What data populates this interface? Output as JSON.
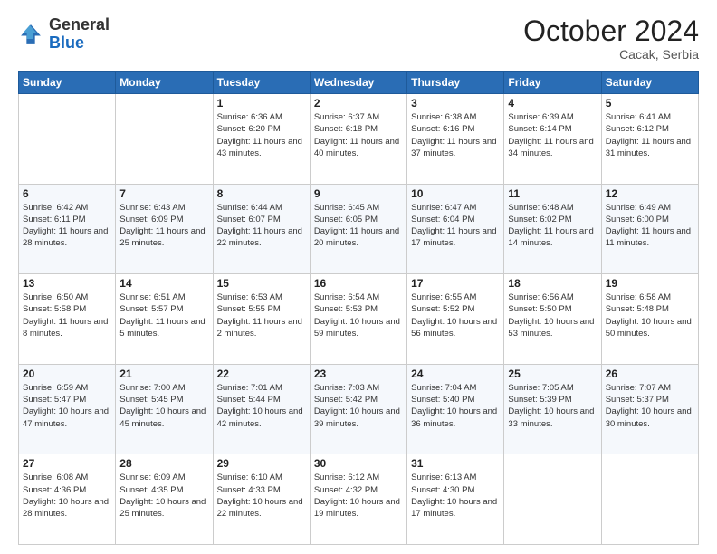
{
  "header": {
    "logo_general": "General",
    "logo_blue": "Blue",
    "month_title": "October 2024",
    "location": "Cacak, Serbia"
  },
  "weekdays": [
    "Sunday",
    "Monday",
    "Tuesday",
    "Wednesday",
    "Thursday",
    "Friday",
    "Saturday"
  ],
  "weeks": [
    [
      {
        "day": "",
        "info": ""
      },
      {
        "day": "",
        "info": ""
      },
      {
        "day": "1",
        "info": "Sunrise: 6:36 AM\nSunset: 6:20 PM\nDaylight: 11 hours and 43 minutes."
      },
      {
        "day": "2",
        "info": "Sunrise: 6:37 AM\nSunset: 6:18 PM\nDaylight: 11 hours and 40 minutes."
      },
      {
        "day": "3",
        "info": "Sunrise: 6:38 AM\nSunset: 6:16 PM\nDaylight: 11 hours and 37 minutes."
      },
      {
        "day": "4",
        "info": "Sunrise: 6:39 AM\nSunset: 6:14 PM\nDaylight: 11 hours and 34 minutes."
      },
      {
        "day": "5",
        "info": "Sunrise: 6:41 AM\nSunset: 6:12 PM\nDaylight: 11 hours and 31 minutes."
      }
    ],
    [
      {
        "day": "6",
        "info": "Sunrise: 6:42 AM\nSunset: 6:11 PM\nDaylight: 11 hours and 28 minutes."
      },
      {
        "day": "7",
        "info": "Sunrise: 6:43 AM\nSunset: 6:09 PM\nDaylight: 11 hours and 25 minutes."
      },
      {
        "day": "8",
        "info": "Sunrise: 6:44 AM\nSunset: 6:07 PM\nDaylight: 11 hours and 22 minutes."
      },
      {
        "day": "9",
        "info": "Sunrise: 6:45 AM\nSunset: 6:05 PM\nDaylight: 11 hours and 20 minutes."
      },
      {
        "day": "10",
        "info": "Sunrise: 6:47 AM\nSunset: 6:04 PM\nDaylight: 11 hours and 17 minutes."
      },
      {
        "day": "11",
        "info": "Sunrise: 6:48 AM\nSunset: 6:02 PM\nDaylight: 11 hours and 14 minutes."
      },
      {
        "day": "12",
        "info": "Sunrise: 6:49 AM\nSunset: 6:00 PM\nDaylight: 11 hours and 11 minutes."
      }
    ],
    [
      {
        "day": "13",
        "info": "Sunrise: 6:50 AM\nSunset: 5:58 PM\nDaylight: 11 hours and 8 minutes."
      },
      {
        "day": "14",
        "info": "Sunrise: 6:51 AM\nSunset: 5:57 PM\nDaylight: 11 hours and 5 minutes."
      },
      {
        "day": "15",
        "info": "Sunrise: 6:53 AM\nSunset: 5:55 PM\nDaylight: 11 hours and 2 minutes."
      },
      {
        "day": "16",
        "info": "Sunrise: 6:54 AM\nSunset: 5:53 PM\nDaylight: 10 hours and 59 minutes."
      },
      {
        "day": "17",
        "info": "Sunrise: 6:55 AM\nSunset: 5:52 PM\nDaylight: 10 hours and 56 minutes."
      },
      {
        "day": "18",
        "info": "Sunrise: 6:56 AM\nSunset: 5:50 PM\nDaylight: 10 hours and 53 minutes."
      },
      {
        "day": "19",
        "info": "Sunrise: 6:58 AM\nSunset: 5:48 PM\nDaylight: 10 hours and 50 minutes."
      }
    ],
    [
      {
        "day": "20",
        "info": "Sunrise: 6:59 AM\nSunset: 5:47 PM\nDaylight: 10 hours and 47 minutes."
      },
      {
        "day": "21",
        "info": "Sunrise: 7:00 AM\nSunset: 5:45 PM\nDaylight: 10 hours and 45 minutes."
      },
      {
        "day": "22",
        "info": "Sunrise: 7:01 AM\nSunset: 5:44 PM\nDaylight: 10 hours and 42 minutes."
      },
      {
        "day": "23",
        "info": "Sunrise: 7:03 AM\nSunset: 5:42 PM\nDaylight: 10 hours and 39 minutes."
      },
      {
        "day": "24",
        "info": "Sunrise: 7:04 AM\nSunset: 5:40 PM\nDaylight: 10 hours and 36 minutes."
      },
      {
        "day": "25",
        "info": "Sunrise: 7:05 AM\nSunset: 5:39 PM\nDaylight: 10 hours and 33 minutes."
      },
      {
        "day": "26",
        "info": "Sunrise: 7:07 AM\nSunset: 5:37 PM\nDaylight: 10 hours and 30 minutes."
      }
    ],
    [
      {
        "day": "27",
        "info": "Sunrise: 6:08 AM\nSunset: 4:36 PM\nDaylight: 10 hours and 28 minutes."
      },
      {
        "day": "28",
        "info": "Sunrise: 6:09 AM\nSunset: 4:35 PM\nDaylight: 10 hours and 25 minutes."
      },
      {
        "day": "29",
        "info": "Sunrise: 6:10 AM\nSunset: 4:33 PM\nDaylight: 10 hours and 22 minutes."
      },
      {
        "day": "30",
        "info": "Sunrise: 6:12 AM\nSunset: 4:32 PM\nDaylight: 10 hours and 19 minutes."
      },
      {
        "day": "31",
        "info": "Sunrise: 6:13 AM\nSunset: 4:30 PM\nDaylight: 10 hours and 17 minutes."
      },
      {
        "day": "",
        "info": ""
      },
      {
        "day": "",
        "info": ""
      }
    ]
  ]
}
